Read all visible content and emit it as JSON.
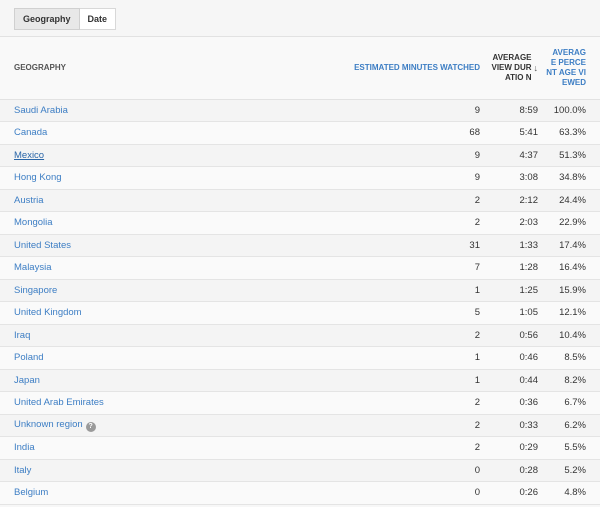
{
  "tabs": [
    {
      "label": "Geography",
      "active": true
    },
    {
      "label": "Date",
      "active": false
    }
  ],
  "table": {
    "columns": {
      "geography": "GEOGRAPHY",
      "minutes": "ESTIMATED MINUTES WATCHED",
      "duration": "AVERAGE VIEW DURATIO N",
      "duration_sort_icon": "↓",
      "percent": "AVERAG E PERCENT AGE VIEWED"
    },
    "rows": [
      {
        "geo": "Saudi Arabia",
        "minutes": "9",
        "duration": "8:59",
        "percent": "100.0%"
      },
      {
        "geo": "Canada",
        "minutes": "68",
        "duration": "5:41",
        "percent": "63.3%"
      },
      {
        "geo": "Mexico",
        "minutes": "9",
        "duration": "4:37",
        "percent": "51.3%"
      },
      {
        "geo": "Hong Kong",
        "minutes": "9",
        "duration": "3:08",
        "percent": "34.8%"
      },
      {
        "geo": "Austria",
        "minutes": "2",
        "duration": "2:12",
        "percent": "24.4%"
      },
      {
        "geo": "Mongolia",
        "minutes": "2",
        "duration": "2:03",
        "percent": "22.9%"
      },
      {
        "geo": "United States",
        "minutes": "31",
        "duration": "1:33",
        "percent": "17.4%"
      },
      {
        "geo": "Malaysia",
        "minutes": "7",
        "duration": "1:28",
        "percent": "16.4%"
      },
      {
        "geo": "Singapore",
        "minutes": "1",
        "duration": "1:25",
        "percent": "15.9%"
      },
      {
        "geo": "United Kingdom",
        "minutes": "5",
        "duration": "1:05",
        "percent": "12.1%"
      },
      {
        "geo": "Iraq",
        "minutes": "2",
        "duration": "0:56",
        "percent": "10.4%"
      },
      {
        "geo": "Poland",
        "minutes": "1",
        "duration": "0:46",
        "percent": "8.5%"
      },
      {
        "geo": "Japan",
        "minutes": "1",
        "duration": "0:44",
        "percent": "8.2%"
      },
      {
        "geo": "United Arab Emirates",
        "minutes": "2",
        "duration": "0:36",
        "percent": "6.7%"
      },
      {
        "geo": "Unknown region",
        "minutes": "2",
        "duration": "0:33",
        "percent": "6.2%",
        "help_icon": "?"
      },
      {
        "geo": "India",
        "minutes": "2",
        "duration": "0:29",
        "percent": "5.5%"
      },
      {
        "geo": "Italy",
        "minutes": "0",
        "duration": "0:28",
        "percent": "5.2%"
      },
      {
        "geo": "Belgium",
        "minutes": "0",
        "duration": "0:26",
        "percent": "4.8%"
      }
    ]
  },
  "colors": {
    "link": "#3d7ec4",
    "text": "#333333"
  }
}
